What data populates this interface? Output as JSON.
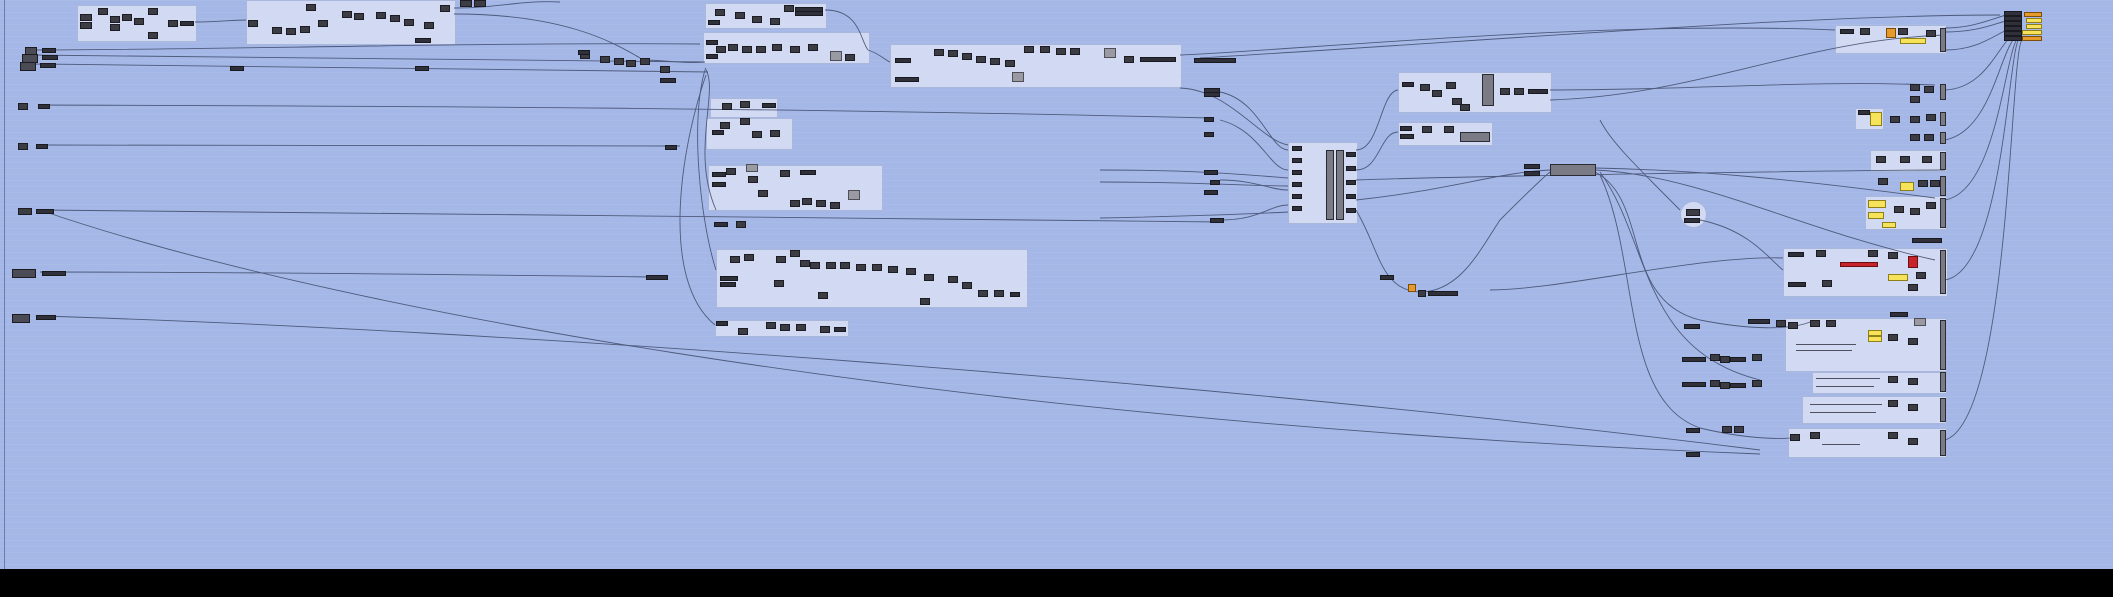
{
  "app": {
    "name": "",
    "view": "node-graph-canvas"
  },
  "colors": {
    "canvas": "#a4b7e6",
    "group": "#dae2f4",
    "wire": "#3f4a6a",
    "component": "#3c3c44",
    "panel_yellow": "#f6e35a",
    "panel_orange": "#e59a2a",
    "panel_red": "#c8232b",
    "bottom_bar": "#000000"
  },
  "status_bar": {
    "text": ""
  }
}
